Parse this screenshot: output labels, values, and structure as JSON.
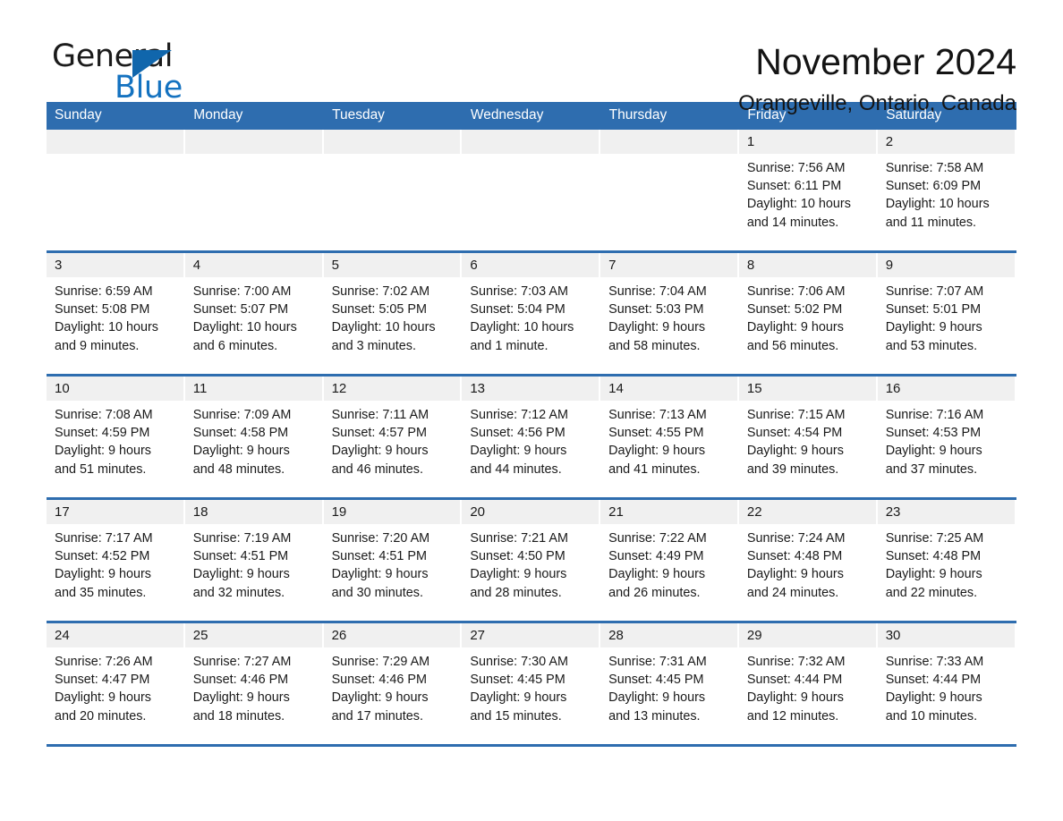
{
  "logo": {
    "word_one": "General",
    "word_two": "Blue",
    "triangle_color": "#1066ac",
    "blue_text_color": "#1472c0"
  },
  "header": {
    "month_title": "November 2024",
    "location": "Orangeville, Ontario, Canada"
  },
  "theme": {
    "header_blue": "#2e6daf",
    "daynum_band": "#f0f0f0",
    "page_background": "#ffffff",
    "text": "#1a1a1a"
  },
  "calendar": {
    "weekday_headers": [
      "Sunday",
      "Monday",
      "Tuesday",
      "Wednesday",
      "Thursday",
      "Friday",
      "Saturday"
    ],
    "weeks": [
      [
        {
          "day": "",
          "sunrise": "",
          "sunset": "",
          "daylight_line1": "",
          "daylight_line2": ""
        },
        {
          "day": "",
          "sunrise": "",
          "sunset": "",
          "daylight_line1": "",
          "daylight_line2": ""
        },
        {
          "day": "",
          "sunrise": "",
          "sunset": "",
          "daylight_line1": "",
          "daylight_line2": ""
        },
        {
          "day": "",
          "sunrise": "",
          "sunset": "",
          "daylight_line1": "",
          "daylight_line2": ""
        },
        {
          "day": "",
          "sunrise": "",
          "sunset": "",
          "daylight_line1": "",
          "daylight_line2": ""
        },
        {
          "day": "1",
          "sunrise": "Sunrise: 7:56 AM",
          "sunset": "Sunset: 6:11 PM",
          "daylight_line1": "Daylight: 10 hours",
          "daylight_line2": "and 14 minutes."
        },
        {
          "day": "2",
          "sunrise": "Sunrise: 7:58 AM",
          "sunset": "Sunset: 6:09 PM",
          "daylight_line1": "Daylight: 10 hours",
          "daylight_line2": "and 11 minutes."
        }
      ],
      [
        {
          "day": "3",
          "sunrise": "Sunrise: 6:59 AM",
          "sunset": "Sunset: 5:08 PM",
          "daylight_line1": "Daylight: 10 hours",
          "daylight_line2": "and 9 minutes."
        },
        {
          "day": "4",
          "sunrise": "Sunrise: 7:00 AM",
          "sunset": "Sunset: 5:07 PM",
          "daylight_line1": "Daylight: 10 hours",
          "daylight_line2": "and 6 minutes."
        },
        {
          "day": "5",
          "sunrise": "Sunrise: 7:02 AM",
          "sunset": "Sunset: 5:05 PM",
          "daylight_line1": "Daylight: 10 hours",
          "daylight_line2": "and 3 minutes."
        },
        {
          "day": "6",
          "sunrise": "Sunrise: 7:03 AM",
          "sunset": "Sunset: 5:04 PM",
          "daylight_line1": "Daylight: 10 hours",
          "daylight_line2": "and 1 minute."
        },
        {
          "day": "7",
          "sunrise": "Sunrise: 7:04 AM",
          "sunset": "Sunset: 5:03 PM",
          "daylight_line1": "Daylight: 9 hours",
          "daylight_line2": "and 58 minutes."
        },
        {
          "day": "8",
          "sunrise": "Sunrise: 7:06 AM",
          "sunset": "Sunset: 5:02 PM",
          "daylight_line1": "Daylight: 9 hours",
          "daylight_line2": "and 56 minutes."
        },
        {
          "day": "9",
          "sunrise": "Sunrise: 7:07 AM",
          "sunset": "Sunset: 5:01 PM",
          "daylight_line1": "Daylight: 9 hours",
          "daylight_line2": "and 53 minutes."
        }
      ],
      [
        {
          "day": "10",
          "sunrise": "Sunrise: 7:08 AM",
          "sunset": "Sunset: 4:59 PM",
          "daylight_line1": "Daylight: 9 hours",
          "daylight_line2": "and 51 minutes."
        },
        {
          "day": "11",
          "sunrise": "Sunrise: 7:09 AM",
          "sunset": "Sunset: 4:58 PM",
          "daylight_line1": "Daylight: 9 hours",
          "daylight_line2": "and 48 minutes."
        },
        {
          "day": "12",
          "sunrise": "Sunrise: 7:11 AM",
          "sunset": "Sunset: 4:57 PM",
          "daylight_line1": "Daylight: 9 hours",
          "daylight_line2": "and 46 minutes."
        },
        {
          "day": "13",
          "sunrise": "Sunrise: 7:12 AM",
          "sunset": "Sunset: 4:56 PM",
          "daylight_line1": "Daylight: 9 hours",
          "daylight_line2": "and 44 minutes."
        },
        {
          "day": "14",
          "sunrise": "Sunrise: 7:13 AM",
          "sunset": "Sunset: 4:55 PM",
          "daylight_line1": "Daylight: 9 hours",
          "daylight_line2": "and 41 minutes."
        },
        {
          "day": "15",
          "sunrise": "Sunrise: 7:15 AM",
          "sunset": "Sunset: 4:54 PM",
          "daylight_line1": "Daylight: 9 hours",
          "daylight_line2": "and 39 minutes."
        },
        {
          "day": "16",
          "sunrise": "Sunrise: 7:16 AM",
          "sunset": "Sunset: 4:53 PM",
          "daylight_line1": "Daylight: 9 hours",
          "daylight_line2": "and 37 minutes."
        }
      ],
      [
        {
          "day": "17",
          "sunrise": "Sunrise: 7:17 AM",
          "sunset": "Sunset: 4:52 PM",
          "daylight_line1": "Daylight: 9 hours",
          "daylight_line2": "and 35 minutes."
        },
        {
          "day": "18",
          "sunrise": "Sunrise: 7:19 AM",
          "sunset": "Sunset: 4:51 PM",
          "daylight_line1": "Daylight: 9 hours",
          "daylight_line2": "and 32 minutes."
        },
        {
          "day": "19",
          "sunrise": "Sunrise: 7:20 AM",
          "sunset": "Sunset: 4:51 PM",
          "daylight_line1": "Daylight: 9 hours",
          "daylight_line2": "and 30 minutes."
        },
        {
          "day": "20",
          "sunrise": "Sunrise: 7:21 AM",
          "sunset": "Sunset: 4:50 PM",
          "daylight_line1": "Daylight: 9 hours",
          "daylight_line2": "and 28 minutes."
        },
        {
          "day": "21",
          "sunrise": "Sunrise: 7:22 AM",
          "sunset": "Sunset: 4:49 PM",
          "daylight_line1": "Daylight: 9 hours",
          "daylight_line2": "and 26 minutes."
        },
        {
          "day": "22",
          "sunrise": "Sunrise: 7:24 AM",
          "sunset": "Sunset: 4:48 PM",
          "daylight_line1": "Daylight: 9 hours",
          "daylight_line2": "and 24 minutes."
        },
        {
          "day": "23",
          "sunrise": "Sunrise: 7:25 AM",
          "sunset": "Sunset: 4:48 PM",
          "daylight_line1": "Daylight: 9 hours",
          "daylight_line2": "and 22 minutes."
        }
      ],
      [
        {
          "day": "24",
          "sunrise": "Sunrise: 7:26 AM",
          "sunset": "Sunset: 4:47 PM",
          "daylight_line1": "Daylight: 9 hours",
          "daylight_line2": "and 20 minutes."
        },
        {
          "day": "25",
          "sunrise": "Sunrise: 7:27 AM",
          "sunset": "Sunset: 4:46 PM",
          "daylight_line1": "Daylight: 9 hours",
          "daylight_line2": "and 18 minutes."
        },
        {
          "day": "26",
          "sunrise": "Sunrise: 7:29 AM",
          "sunset": "Sunset: 4:46 PM",
          "daylight_line1": "Daylight: 9 hours",
          "daylight_line2": "and 17 minutes."
        },
        {
          "day": "27",
          "sunrise": "Sunrise: 7:30 AM",
          "sunset": "Sunset: 4:45 PM",
          "daylight_line1": "Daylight: 9 hours",
          "daylight_line2": "and 15 minutes."
        },
        {
          "day": "28",
          "sunrise": "Sunrise: 7:31 AM",
          "sunset": "Sunset: 4:45 PM",
          "daylight_line1": "Daylight: 9 hours",
          "daylight_line2": "and 13 minutes."
        },
        {
          "day": "29",
          "sunrise": "Sunrise: 7:32 AM",
          "sunset": "Sunset: 4:44 PM",
          "daylight_line1": "Daylight: 9 hours",
          "daylight_line2": "and 12 minutes."
        },
        {
          "day": "30",
          "sunrise": "Sunrise: 7:33 AM",
          "sunset": "Sunset: 4:44 PM",
          "daylight_line1": "Daylight: 9 hours",
          "daylight_line2": "and 10 minutes."
        }
      ]
    ]
  }
}
